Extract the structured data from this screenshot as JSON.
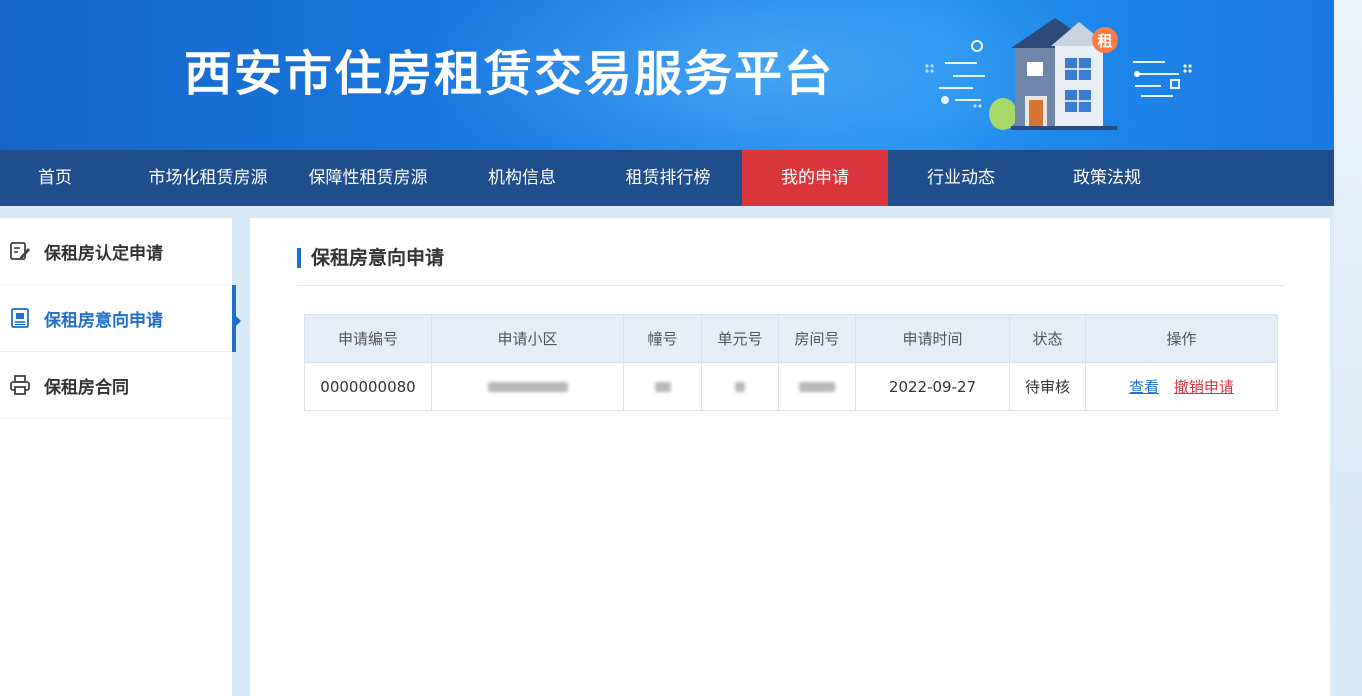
{
  "banner": {
    "title": "西安市住房租赁交易服务平台",
    "house_badge": "租"
  },
  "nav": {
    "items": [
      {
        "label": "首页"
      },
      {
        "label": "市场化租赁房源"
      },
      {
        "label": "保障性租赁房源"
      },
      {
        "label": "机构信息"
      },
      {
        "label": "租赁排行榜"
      },
      {
        "label": "我的申请"
      },
      {
        "label": "行业动态"
      },
      {
        "label": "政策法规"
      }
    ],
    "active_label": "我的申请"
  },
  "sidebar": {
    "items": [
      {
        "label": "保租房认定申请",
        "icon": "edit-icon"
      },
      {
        "label": "保租房意向申请",
        "icon": "document-icon"
      },
      {
        "label": "保租房合同",
        "icon": "printer-icon"
      }
    ],
    "active_label": "保租房意向申请"
  },
  "main": {
    "title": "保租房意向申请",
    "table": {
      "columns": [
        "申请编号",
        "申请小区",
        "幢号",
        "单元号",
        "房间号",
        "申请时间",
        "状态",
        "操作"
      ],
      "rows": [
        {
          "id": "0000000080",
          "date": "2022-09-27",
          "status": "待审核",
          "view": "查看",
          "cancel": "撤销申请"
        }
      ]
    }
  },
  "colors": {
    "banner": "#1a7ee6",
    "nav": "#1e4e8c",
    "active_nav": "#d9363e",
    "accent": "#1f6fcf"
  }
}
